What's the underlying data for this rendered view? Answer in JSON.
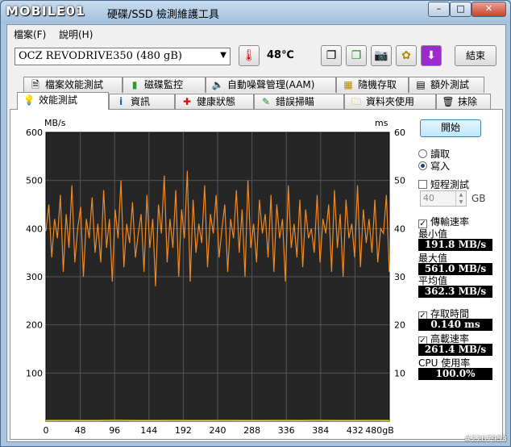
{
  "app": {
    "logo_text": "MOBILE01",
    "title": "硬碟/SSD 檢測維護工具"
  },
  "window_buttons": {
    "minimize": "–",
    "maximize": "□",
    "close": "✕"
  },
  "menu": [
    {
      "label": "檔案(F)"
    },
    {
      "label": "說明(H)"
    }
  ],
  "toolbar": {
    "drive": "OCZ    REVODRIVE350 (480 gB)",
    "temperature": "48℃",
    "exit_label": "結束",
    "icons": [
      "thermometer-icon",
      "copy-text-icon",
      "copy-image-icon",
      "camera-icon",
      "tools-icon",
      "download-icon"
    ]
  },
  "tabs_top": [
    {
      "label": "檔案效能測試",
      "icon": "file-benchmark-icon"
    },
    {
      "label": "磁碟監控",
      "icon": "disk-monitor-icon"
    },
    {
      "label": "自動噪聲管理(AAM)",
      "icon": "speaker-icon"
    },
    {
      "label": "隨機存取",
      "icon": "random-access-icon"
    },
    {
      "label": "額外測試",
      "icon": "extra-tests-icon"
    }
  ],
  "tabs_bottom": [
    {
      "label": "效能測試",
      "icon": "bulb-icon",
      "active": true
    },
    {
      "label": "資訊",
      "icon": "info-icon"
    },
    {
      "label": "健康狀態",
      "icon": "health-cross-icon"
    },
    {
      "label": "錯誤掃瞄",
      "icon": "error-scan-icon"
    },
    {
      "label": "資料夾使用",
      "icon": "folder-icon"
    },
    {
      "label": "抹除",
      "icon": "trash-icon"
    }
  ],
  "side": {
    "start_label": "開始",
    "read_label": "讀取",
    "write_label": "寫入",
    "mode_selected": "write",
    "short_test_label": "短程測試",
    "short_test_checked": false,
    "size_value": "40",
    "size_unit": "GB",
    "transfer_rate_label": "傳輸速率",
    "transfer_rate_checked": true,
    "min_label": "最小值",
    "min_value": "191.8 MB/s",
    "max_label": "最大值",
    "max_value": "561.0 MB/s",
    "avg_label": "平均值",
    "avg_value": "362.3 MB/s",
    "access_time_label": "存取時間",
    "access_time_checked": true,
    "access_time_value": "0.140 ms",
    "burst_rate_label": "高載速率",
    "burst_rate_checked": true,
    "burst_rate_value": "261.4 MB/s",
    "cpu_label": "CPU 使用率",
    "cpu_value": "100.0%"
  },
  "watermark": "#2207953",
  "chart_data": {
    "type": "line",
    "left_axis_unit": "MB/s",
    "right_axis_unit": "ms",
    "y_left_range": [
      0,
      600
    ],
    "y_right_range": [
      0,
      60
    ],
    "y_left_ticks": [
      "600",
      "500",
      "400",
      "300",
      "200",
      "100"
    ],
    "y_right_ticks": [
      "60",
      "50",
      "40",
      "30",
      "20",
      "10"
    ],
    "x_range": [
      0,
      480
    ],
    "x_ticks": [
      "0",
      "48",
      "96",
      "144",
      "192",
      "240",
      "288",
      "336",
      "384",
      "432",
      "480gB"
    ],
    "grid": true,
    "series": [
      {
        "color": "#f08a24",
        "values": [
          395,
          450,
          340,
          420,
          380,
          470,
          310,
          430,
          360,
          490,
          330,
          400,
          445,
          300,
          420,
          380,
          465,
          350,
          410,
          330,
          480,
          360,
          420,
          290,
          440,
          380,
          500,
          320,
          410,
          370,
          455,
          340,
          390,
          430,
          310,
          470,
          360,
          420,
          280,
          450,
          390,
          510,
          330,
          420,
          360,
          480,
          300,
          440,
          380,
          520,
          290,
          460,
          350,
          410,
          370,
          490,
          320,
          430,
          390,
          470,
          340,
          400,
          450,
          310,
          420,
          380,
          480,
          350,
          440,
          300,
          500,
          360,
          410,
          330,
          460,
          390,
          430,
          340,
          470,
          310,
          450,
          380,
          420,
          290,
          490,
          360,
          410,
          340,
          460,
          320,
          440,
          380,
          400,
          350,
          470,
          330,
          420,
          390,
          450,
          310,
          480,
          360,
          430,
          300,
          460,
          380,
          410,
          340,
          490,
          320,
          440,
          370,
          420,
          350,
          460,
          330,
          400,
          390,
          470,
          310
        ]
      },
      {
        "color": "#e0e000",
        "values": [
          1.4,
          1.5,
          1.3,
          1.4,
          1.6,
          1.4,
          1.3,
          1.5,
          1.4,
          1.4,
          1.5,
          1.3,
          1.4,
          1.5,
          1.4,
          1.6,
          1.3,
          1.4,
          1.5,
          1.4
        ]
      }
    ]
  }
}
